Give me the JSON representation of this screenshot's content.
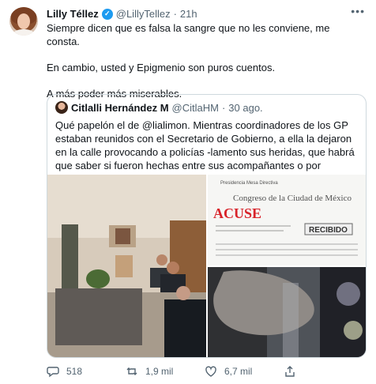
{
  "tweet": {
    "author_name": "Lilly Téllez",
    "handle": "@LillyTellez",
    "separator": "·",
    "time": "21h",
    "lines": [
      "Siempre dicen que es falsa la sangre que no les conviene, me consta.",
      "En cambio, usted y Epigmenio son puros cuentos.",
      "A más poder más miserables."
    ]
  },
  "quote": {
    "author_name": "Citlalli Hernández M",
    "handle": "@CitlaHM",
    "separator": "·",
    "time": "30 ago.",
    "text": "Qué papelón el de @lialimon. Mientras coordinadores de los GP estaban reunidos con el Secretario de Gobierno, a ella la dejaron en la calle provocando a policías -lamento sus heridas, que habrá que saber si fueron hechas entre sus acompañantes o por policías-. No se deje."
  },
  "document": {
    "header": "Presidencia Mesa Directiva",
    "institution": "Congreso de la Ciudad de México",
    "stamp": "ACUSE",
    "received": "RECIBIDO"
  },
  "actions": {
    "replies": "518",
    "retweets": "1,9 mil",
    "likes": "6,7 mil"
  },
  "colors": {
    "verified": "#1d9bf0",
    "muted": "#536471",
    "border": "#cfd9de",
    "stamp": "#d8232a"
  }
}
